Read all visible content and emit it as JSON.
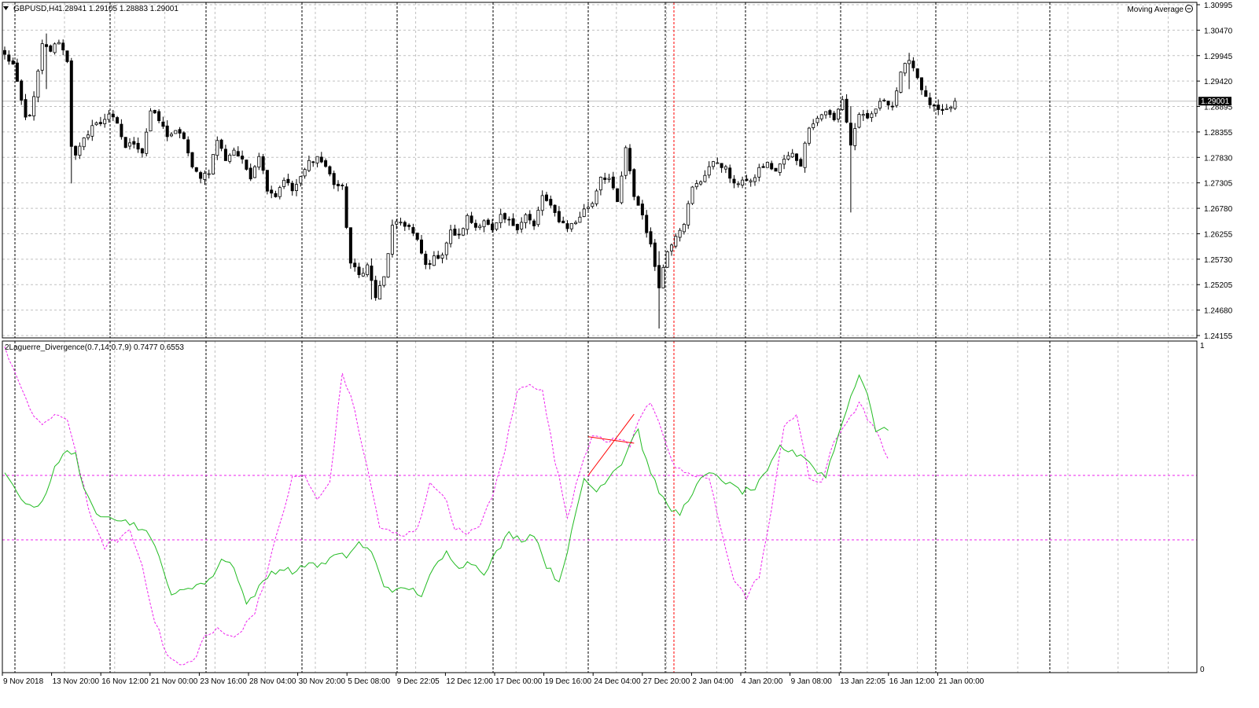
{
  "main_header": {
    "symbol_text": "GBPUSD,H4",
    "ohlc_text": "1.28941 1.29105 1.28883 1.29001",
    "indicator_label": "Moving Average"
  },
  "sub_header": {
    "text": "2Laguerre_Divergence(0.7,14;0.7,9) 0.7477 0.6553"
  },
  "price_axis": {
    "ticks": [
      "1.30995",
      "1.30470",
      "1.29945",
      "1.29420",
      "1.28895",
      "1.28355",
      "1.27830",
      "1.27305",
      "1.26780",
      "1.26255",
      "1.25730",
      "1.25205",
      "1.24680",
      "1.24155"
    ],
    "current_price": "1.29001"
  },
  "sub_axis": {
    "top": "1",
    "bottom": "0"
  },
  "time_axis": {
    "labels": [
      "9 Nov 2018",
      "13 Nov 20:00",
      "16 Nov 12:00",
      "21 Nov 00:00",
      "23 Nov 16:00",
      "28 Nov 04:00",
      "30 Nov 20:00",
      "5 Dec 08:00",
      "9 Dec 22:05",
      "12 Dec 12:00",
      "17 Dec 00:00",
      "19 Dec 16:00",
      "24 Dec 04:00",
      "27 Dec 20:00",
      "2 Jan 04:00",
      "4 Jan 20:00",
      "9 Jan 08:00",
      "13 Jan 22:05",
      "16 Jan 12:00",
      "21 Jan 00:00"
    ]
  },
  "colors": {
    "background": "#ffffff",
    "candle": "#000000",
    "grid": "#c0c0c0",
    "laguerre_line": "#22bb22",
    "signal_line": "#ee22ee",
    "divergence": "#ff0000",
    "level_line": "#ee22ee"
  },
  "chart_data": [
    {
      "type": "candlestick",
      "symbol": "GBPUSD",
      "timeframe": "H4",
      "ylim": [
        1.24155,
        1.30995
      ],
      "close_path": [
        [
          0,
          1.2995
        ],
        [
          2,
          1.2975
        ],
        [
          3,
          1.2935
        ],
        [
          5,
          1.2865
        ],
        [
          6,
          1.2875
        ],
        [
          7,
          1.2905
        ],
        [
          9,
          1.3015
        ],
        [
          11,
          1.3005
        ],
        [
          13,
          1.3025
        ],
        [
          15,
          1.2985
        ],
        [
          16,
          1.281
        ],
        [
          17,
          1.2785
        ],
        [
          19,
          1.282
        ],
        [
          21,
          1.285
        ],
        [
          23,
          1.2855
        ],
        [
          25,
          1.2875
        ],
        [
          27,
          1.285
        ],
        [
          29,
          1.2805
        ],
        [
          31,
          1.2815
        ],
        [
          33,
          1.2795
        ],
        [
          35,
          1.288
        ],
        [
          37,
          1.286
        ],
        [
          39,
          1.283
        ],
        [
          41,
          1.2835
        ],
        [
          43,
          1.2825
        ],
        [
          45,
          1.276
        ],
        [
          47,
          1.2745
        ],
        [
          49,
          1.2755
        ],
        [
          51,
          1.282
        ],
        [
          53,
          1.278
        ],
        [
          55,
          1.28
        ],
        [
          57,
          1.2775
        ],
        [
          59,
          1.2745
        ],
        [
          61,
          1.279
        ],
        [
          63,
          1.272
        ],
        [
          65,
          1.2705
        ],
        [
          67,
          1.274
        ],
        [
          69,
          1.2715
        ],
        [
          71,
          1.274
        ],
        [
          73,
          1.2775
        ],
        [
          75,
          1.2785
        ],
        [
          77,
          1.2765
        ],
        [
          79,
          1.273
        ],
        [
          81,
          1.272
        ],
        [
          83,
          1.2565
        ],
        [
          85,
          1.254
        ],
        [
          87,
          1.256
        ],
        [
          89,
          1.2495
        ],
        [
          91,
          1.2535
        ],
        [
          93,
          1.264
        ],
        [
          95,
          1.265
        ],
        [
          97,
          1.264
        ],
        [
          99,
          1.261
        ],
        [
          101,
          1.256
        ],
        [
          103,
          1.2575
        ],
        [
          105,
          1.2585
        ],
        [
          107,
          1.263
        ],
        [
          109,
          1.262
        ],
        [
          111,
          1.266
        ],
        [
          113,
          1.264
        ],
        [
          115,
          1.2655
        ],
        [
          117,
          1.263
        ],
        [
          119,
          1.266
        ],
        [
          121,
          1.265
        ],
        [
          123,
          1.264
        ],
        [
          125,
          1.2665
        ],
        [
          127,
          1.264
        ],
        [
          129,
          1.2705
        ],
        [
          131,
          1.268
        ],
        [
          133,
          1.2655
        ],
        [
          135,
          1.264
        ],
        [
          137,
          1.265
        ],
        [
          139,
          1.2675
        ],
        [
          141,
          1.269
        ],
        [
          143,
          1.2745
        ],
        [
          145,
          1.274
        ],
        [
          147,
          1.269
        ],
        [
          149,
          1.28
        ],
        [
          151,
          1.2705
        ],
        [
          153,
          1.2665
        ],
        [
          155,
          1.26
        ],
        [
          157,
          1.252
        ],
        [
          159,
          1.259
        ],
        [
          161,
          1.2625
        ],
        [
          163,
          1.265
        ],
        [
          165,
          1.272
        ],
        [
          167,
          1.2735
        ],
        [
          169,
          1.2765
        ],
        [
          171,
          1.2775
        ],
        [
          173,
          1.276
        ],
        [
          175,
          1.2725
        ],
        [
          177,
          1.274
        ],
        [
          179,
          1.273
        ],
        [
          181,
          1.276
        ],
        [
          183,
          1.277
        ],
        [
          185,
          1.2755
        ],
        [
          187,
          1.278
        ],
        [
          189,
          1.279
        ],
        [
          191,
          1.277
        ],
        [
          193,
          1.285
        ],
        [
          195,
          1.2865
        ],
        [
          197,
          1.288
        ],
        [
          199,
          1.286
        ],
        [
          201,
          1.2905
        ],
        [
          203,
          1.281
        ],
        [
          205,
          1.2875
        ],
        [
          207,
          1.286
        ],
        [
          209,
          1.2885
        ],
        [
          211,
          1.2905
        ],
        [
          213,
          1.289
        ],
        [
          215,
          1.2955
        ],
        [
          217,
          1.299
        ],
        [
          219,
          1.295
        ],
        [
          221,
          1.2905
        ],
        [
          223,
          1.2885
        ],
        [
          225,
          1.2875
        ],
        [
          227,
          1.2888
        ],
        [
          228,
          1.29
        ]
      ],
      "extremes": [
        {
          "index": 10,
          "high": 1.304,
          "low": 1.2925
        },
        {
          "index": 16,
          "high": 1.2915,
          "low": 1.273
        },
        {
          "index": 88,
          "high": 1.2575,
          "low": 1.249
        },
        {
          "index": 157,
          "high": 1.259,
          "low": 1.243
        },
        {
          "index": 203,
          "high": 1.289,
          "low": 1.267
        },
        {
          "index": 217,
          "high": 1.3,
          "low": 1.2925
        }
      ]
    },
    {
      "type": "line",
      "title": "2Laguerre_Divergence(0.7,14;0.7,9)",
      "ylim": [
        0,
        1
      ],
      "levels": [
        0.6,
        0.4
      ],
      "series": [
        {
          "values_path": [
            [
              0,
              0.6
            ],
            [
              3,
              0.55
            ],
            [
              6,
              0.5
            ],
            [
              9,
              0.52
            ],
            [
              12,
              0.62
            ],
            [
              15,
              0.68
            ],
            [
              17,
              0.67
            ],
            [
              19,
              0.55
            ],
            [
              22,
              0.48
            ],
            [
              25,
              0.48
            ],
            [
              28,
              0.46
            ],
            [
              31,
              0.45
            ],
            [
              34,
              0.42
            ],
            [
              37,
              0.36
            ],
            [
              40,
              0.22
            ],
            [
              43,
              0.25
            ],
            [
              46,
              0.26
            ],
            [
              49,
              0.27
            ],
            [
              52,
              0.34
            ],
            [
              55,
              0.32
            ],
            [
              58,
              0.2
            ],
            [
              61,
              0.25
            ],
            [
              64,
              0.3
            ],
            [
              67,
              0.31
            ],
            [
              70,
              0.3
            ],
            [
              73,
              0.33
            ],
            [
              76,
              0.32
            ],
            [
              79,
              0.35
            ],
            [
              82,
              0.35
            ],
            [
              85,
              0.39
            ],
            [
              88,
              0.36
            ],
            [
              91,
              0.26
            ],
            [
              94,
              0.24
            ],
            [
              97,
              0.25
            ],
            [
              100,
              0.23
            ],
            [
              103,
              0.31
            ],
            [
              106,
              0.36
            ],
            [
              109,
              0.32
            ],
            [
              112,
              0.33
            ],
            [
              115,
              0.3
            ],
            [
              118,
              0.36
            ],
            [
              121,
              0.42
            ],
            [
              124,
              0.4
            ],
            [
              127,
              0.42
            ],
            [
              130,
              0.32
            ],
            [
              133,
              0.27
            ],
            [
              136,
              0.42
            ],
            [
              139,
              0.59
            ],
            [
              142,
              0.55
            ],
            [
              145,
              0.6
            ],
            [
              148,
              0.64
            ],
            [
              150,
              0.7
            ],
            [
              152,
              0.75
            ],
            [
              153,
              0.68
            ],
            [
              156,
              0.58
            ],
            [
              159,
              0.5
            ],
            [
              162,
              0.48
            ],
            [
              165,
              0.55
            ],
            [
              168,
              0.6
            ],
            [
              171,
              0.6
            ],
            [
              174,
              0.57
            ],
            [
              177,
              0.55
            ],
            [
              180,
              0.56
            ],
            [
              183,
              0.61
            ],
            [
              186,
              0.69
            ],
            [
              189,
              0.67
            ],
            [
              192,
              0.66
            ],
            [
              195,
              0.61
            ],
            [
              197,
              0.6
            ],
            [
              199,
              0.68
            ],
            [
              202,
              0.81
            ],
            [
              205,
              0.91
            ],
            [
              207,
              0.86
            ],
            [
              209,
              0.74
            ],
            [
              211,
              0.74
            ],
            [
              212,
              0.74
            ]
          ]
        },
        {
          "values_path": [
            [
              0,
              1.0
            ],
            [
              3,
              0.9
            ],
            [
              6,
              0.8
            ],
            [
              9,
              0.76
            ],
            [
              12,
              0.78
            ],
            [
              15,
              0.78
            ],
            [
              18,
              0.62
            ],
            [
              21,
              0.45
            ],
            [
              24,
              0.38
            ],
            [
              27,
              0.4
            ],
            [
              30,
              0.43
            ],
            [
              33,
              0.32
            ],
            [
              36,
              0.15
            ],
            [
              39,
              0.04
            ],
            [
              42,
              0.01
            ],
            [
              45,
              0.02
            ],
            [
              48,
              0.1
            ],
            [
              51,
              0.12
            ],
            [
              54,
              0.1
            ],
            [
              57,
              0.12
            ],
            [
              60,
              0.18
            ],
            [
              63,
              0.3
            ],
            [
              66,
              0.45
            ],
            [
              69,
              0.59
            ],
            [
              72,
              0.6
            ],
            [
              75,
              0.52
            ],
            [
              78,
              0.58
            ],
            [
              81,
              0.92
            ],
            [
              84,
              0.8
            ],
            [
              87,
              0.62
            ],
            [
              90,
              0.44
            ],
            [
              93,
              0.42
            ],
            [
              96,
              0.41
            ],
            [
              99,
              0.44
            ],
            [
              102,
              0.57
            ],
            [
              105,
              0.55
            ],
            [
              108,
              0.44
            ],
            [
              111,
              0.41
            ],
            [
              114,
              0.45
            ],
            [
              117,
              0.53
            ],
            [
              120,
              0.68
            ],
            [
              123,
              0.86
            ],
            [
              126,
              0.89
            ],
            [
              129,
              0.86
            ],
            [
              132,
              0.65
            ],
            [
              135,
              0.47
            ],
            [
              138,
              0.62
            ],
            [
              141,
              0.73
            ],
            [
              144,
              0.7
            ],
            [
              147,
              0.72
            ],
            [
              150,
              0.69
            ],
            [
              153,
              0.8
            ],
            [
              155,
              0.83
            ],
            [
              157,
              0.77
            ],
            [
              160,
              0.64
            ],
            [
              163,
              0.6
            ],
            [
              166,
              0.6
            ],
            [
              169,
              0.59
            ],
            [
              172,
              0.42
            ],
            [
              175,
              0.28
            ],
            [
              178,
              0.22
            ],
            [
              181,
              0.29
            ],
            [
              184,
              0.49
            ],
            [
              187,
              0.76
            ],
            [
              190,
              0.79
            ],
            [
              193,
              0.59
            ],
            [
              196,
              0.58
            ],
            [
              199,
              0.7
            ],
            [
              202,
              0.77
            ],
            [
              205,
              0.82
            ],
            [
              208,
              0.76
            ],
            [
              211,
              0.68
            ],
            [
              212,
              0.65
            ]
          ]
        }
      ],
      "divergence_lines": [
        {
          "points": [
            [
              140,
              0.72
            ],
            [
              151,
              0.7
            ]
          ]
        },
        {
          "points": [
            [
              140,
              0.6
            ],
            [
              151,
              0.79
            ]
          ]
        }
      ]
    }
  ]
}
